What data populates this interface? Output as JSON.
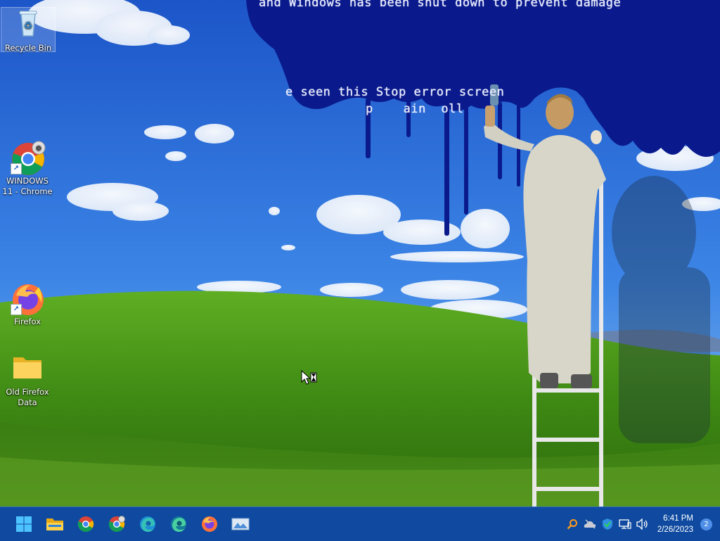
{
  "desktop": {
    "icons": [
      {
        "label": "Recycle Bin",
        "icon": "recycle-bin-icon"
      },
      {
        "label": "WINDOWS 11 - Chrome",
        "icon": "chrome-icon"
      },
      {
        "label": "Firefox",
        "icon": "firefox-icon"
      },
      {
        "label": "Old Firefox Data",
        "icon": "folder-icon"
      }
    ]
  },
  "wallpaper": {
    "bsod_line_1": "and Windows has been shut down to prevent damage",
    "bsod_line_2": "e seen this Stop error screen",
    "bsod_line_3": "p    ain  oll"
  },
  "taskbar": {
    "apps": [
      "start-icon",
      "file-explorer-icon",
      "chrome-icon",
      "chrome-canary-icon",
      "edge-icon",
      "edge-dev-icon",
      "firefox-icon",
      "image-viewer-icon"
    ],
    "tray_icons": [
      "search-icon",
      "onedrive-icon",
      "security-icon",
      "network-icon",
      "volume-icon"
    ],
    "clock_time": "6:41 PM",
    "clock_date": "2/26/2023",
    "notification_count": "2"
  },
  "colors": {
    "taskbar": "#0f4aa0",
    "sky": "#2a6fd6",
    "grass": "#4f9a1c",
    "paint": "#0a1a8c"
  }
}
